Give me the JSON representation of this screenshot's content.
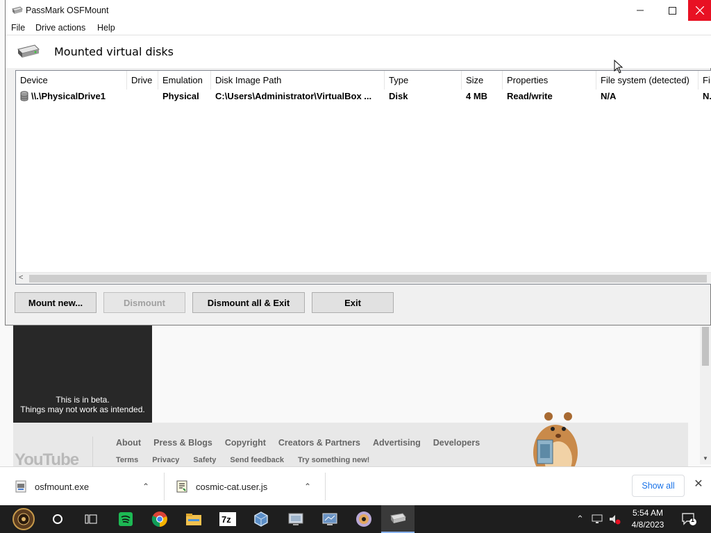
{
  "window": {
    "title": "PassMark OSFMount",
    "header_title": "Mounted virtual disks"
  },
  "menu": [
    "File",
    "Drive actions",
    "Help"
  ],
  "table": {
    "columns": [
      "Device",
      "Drive",
      "Emulation",
      "Disk Image Path",
      "Type",
      "Size",
      "Properties",
      "File system (detected)",
      "Fi"
    ],
    "rows": [
      {
        "device": "\\\\.\\PhysicalDrive1",
        "drive": "",
        "emulation": "Physical",
        "path": "C:\\Users\\Administrator\\VirtualBox ...",
        "type": "Disk",
        "size": "4 MB",
        "properties": "Read/write",
        "filesystem": "N/A",
        "fi": "N."
      }
    ]
  },
  "buttons": {
    "mount_new": "Mount new...",
    "dismount": "Dismount",
    "dismount_all_exit": "Dismount all & Exit",
    "exit": "Exit"
  },
  "background_page": {
    "beta_line1": "This is in beta.",
    "beta_line2": "Things may not work as intended.",
    "footer_links_primary": [
      "About",
      "Press & Blogs",
      "Copyright",
      "Creators & Partners",
      "Advertising",
      "Developers"
    ],
    "footer_links_secondary": [
      "Terms",
      "Privacy",
      "Safety",
      "Send feedback",
      "Try something new!"
    ],
    "logo_text": "YouTube"
  },
  "downloads": {
    "items": [
      {
        "name": "osfmount.exe",
        "icon": "exe-file-icon"
      },
      {
        "name": "cosmic-cat.user.js",
        "icon": "js-file-icon"
      }
    ],
    "show_all": "Show all"
  },
  "taskbar": {
    "time": "5:54 AM",
    "date": "4/8/2023",
    "notification_count": "1",
    "apps": [
      "start",
      "search",
      "task-view",
      "spotify",
      "chrome",
      "file-explorer",
      "7zip",
      "virtualbox",
      "remote-desktop",
      "network-manager",
      "dvd",
      "osfmount"
    ]
  },
  "colors": {
    "close_button": "#e81123",
    "link_blue": "#1a73e8",
    "taskbar": "#1e1e1e"
  }
}
